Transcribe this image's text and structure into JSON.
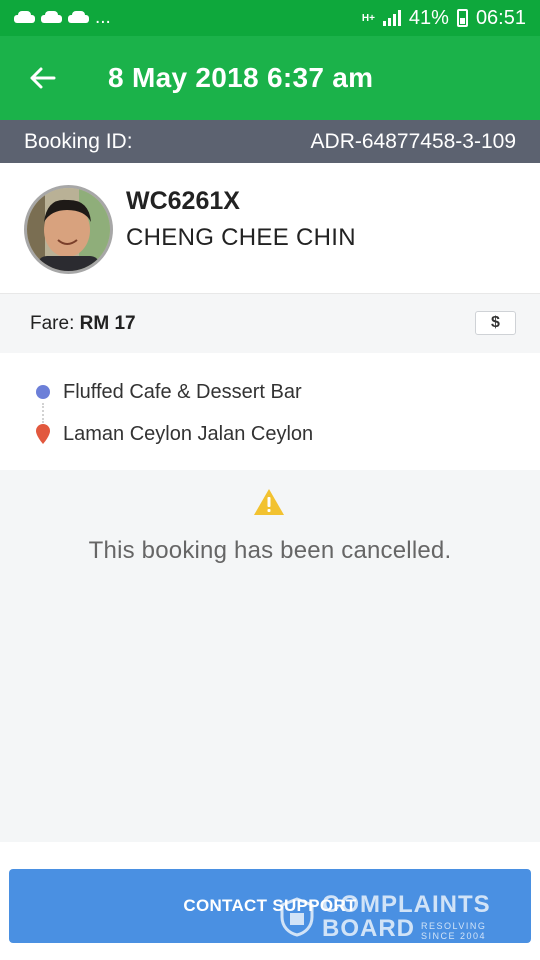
{
  "status_bar": {
    "notifications": [
      "car-icon",
      "car-icon",
      "car-icon"
    ],
    "more": "...",
    "network": "H+",
    "battery": "41%",
    "time": "06:51"
  },
  "app_bar": {
    "back_icon": "arrow-left-icon",
    "title": "8 May 2018 6:37 am"
  },
  "booking": {
    "label": "Booking ID:",
    "id": "ADR-64877458-3-109"
  },
  "driver": {
    "plate": "WC6261X",
    "name": "CHENG CHEE CHIN"
  },
  "fare": {
    "label": "Fare:",
    "value": "RM 17",
    "button_icon": "$"
  },
  "route": {
    "pickup": "Fluffed Cafe & Dessert Bar",
    "dropoff": "Laman Ceylon Jalan Ceylon"
  },
  "status": {
    "icon": "warning-icon",
    "message": "This booking has been cancelled."
  },
  "footer": {
    "contact_label": "CONTACT SUPPORT"
  },
  "watermark": {
    "line1": "COMPLAINTS",
    "line2": "BOARD",
    "tagline_1": "RESOLVING",
    "tagline_2": "SINCE 2004"
  },
  "colors": {
    "status_bar": "#0ea83c",
    "app_bar": "#1bb24a",
    "booking_bar": "#5c6270",
    "button": "#4a90e2",
    "pickup_dot": "#6c7fd8",
    "dropoff_pin": "#e2583e",
    "warning": "#f2c230"
  }
}
